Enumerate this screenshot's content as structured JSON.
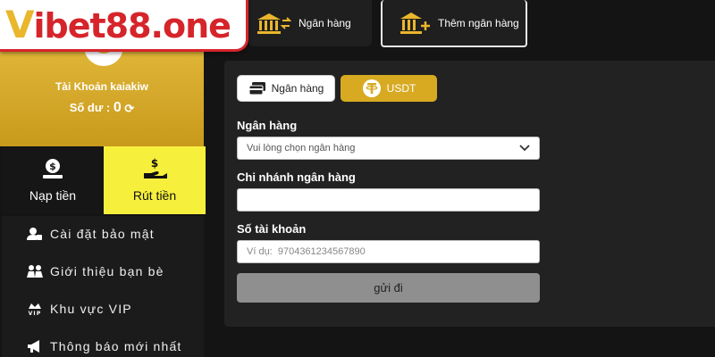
{
  "logo": {
    "first_letter": "V",
    "rest": "ibet88.one"
  },
  "account": {
    "name": "Tài Khoản kaiakiw",
    "balance_label": "Số dư :",
    "balance_value": "0"
  },
  "tiles": {
    "deposit_label": "Nạp tiền",
    "withdraw_label": "Rút tiền"
  },
  "sidemenu": {
    "items": [
      {
        "label": "Cài đặt bảo mật",
        "icon": "user-lock-icon"
      },
      {
        "label": "Giới thiệu bạn bè",
        "icon": "people-icon"
      },
      {
        "label": "Khu vực VIP",
        "icon": "vip-crown-icon"
      },
      {
        "label": "Thông báo mới nhất",
        "icon": "megaphone-icon"
      }
    ]
  },
  "tabs": {
    "bank_label": "Ngân hàng",
    "add_bank_label": "Thêm ngân hàng"
  },
  "form": {
    "method_bank_label": "Ngân hàng",
    "method_usdt_label": "USDT",
    "bank_label": "Ngân hàng",
    "bank_select_value": "Vui lòng chọn ngân hàng",
    "branch_label": "Chi nhánh ngân hàng",
    "branch_value": "",
    "account_label": "Số tài khoản",
    "account_placeholder": "Ví dụ:  9704361234567890",
    "submit_label": "gửi đi"
  },
  "colors": {
    "gold": "#d7aa22",
    "highlight_yellow": "#f6f03d",
    "brand_red": "#d6242b"
  }
}
